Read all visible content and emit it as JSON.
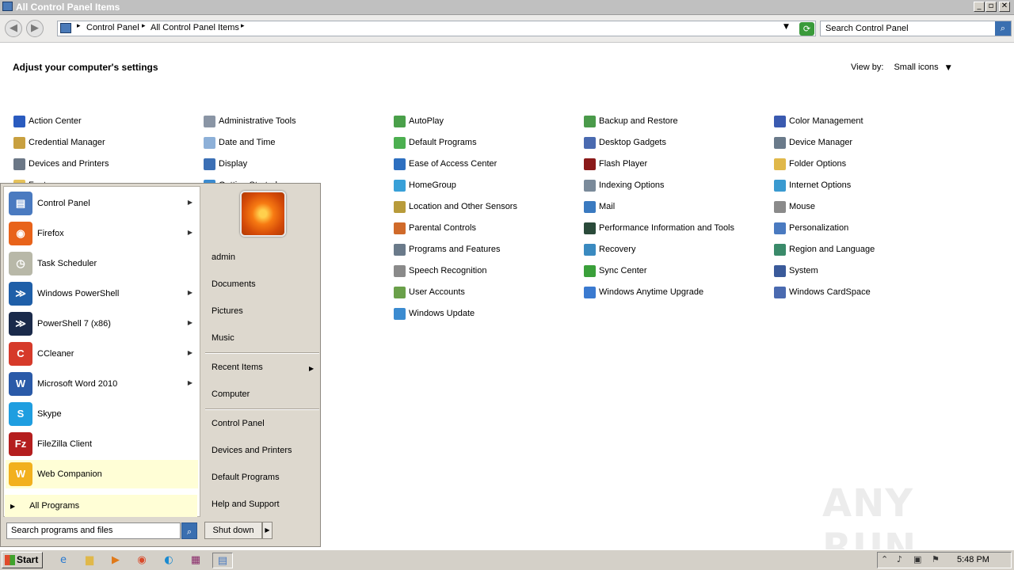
{
  "window": {
    "title": "All Control Panel Items"
  },
  "window_buttons": {
    "minimize": "_",
    "maximize": "▫",
    "close": "✕"
  },
  "nav": {
    "back": "◀",
    "forward": "▶"
  },
  "address": {
    "crumb1": "Control Panel",
    "crumb2": "All Control Panel Items"
  },
  "search": {
    "placeholder": "Search Control Panel"
  },
  "content": {
    "heading": "Adjust your computer's settings",
    "viewby_label": "View by:",
    "viewby_value": "Small icons",
    "columns": [
      [
        {
          "label": "Action Center",
          "icon": "flag-icon",
          "color": "#2a5bbf"
        },
        {
          "label": "Credential Manager",
          "icon": "vault-icon",
          "color": "#c8a040"
        },
        {
          "label": "Devices and Printers",
          "icon": "printer-icon",
          "color": "#6b7786"
        },
        {
          "label": "Fonts",
          "icon": "folder-icon",
          "color": "#e6c25a"
        }
      ],
      [
        {
          "label": "Administrative Tools",
          "icon": "tools-icon",
          "color": "#8a95a5"
        },
        {
          "label": "Date and Time",
          "icon": "calendar-icon",
          "color": "#8db0d8"
        },
        {
          "label": "Display",
          "icon": "monitor-icon",
          "color": "#3b6fb5"
        },
        {
          "label": "Getting Started",
          "icon": "start-icon",
          "color": "#3b8bd0"
        }
      ],
      [
        {
          "label": "AutoPlay",
          "icon": "autoplay-icon",
          "color": "#4aa04a"
        },
        {
          "label": "Default Programs",
          "icon": "default-programs-icon",
          "color": "#4caf50"
        },
        {
          "label": "Ease of Access Center",
          "icon": "ease-access-icon",
          "color": "#2d6fc0"
        },
        {
          "label": "HomeGroup",
          "icon": "homegroup-icon",
          "color": "#38a0d8"
        },
        {
          "label": "Location and Other Sensors",
          "icon": "sensor-icon",
          "color": "#b89b3a"
        },
        {
          "label": "Parental Controls",
          "icon": "parental-icon",
          "color": "#d06a2a"
        },
        {
          "label": "Programs and Features",
          "icon": "programs-icon",
          "color": "#6a7a8a"
        },
        {
          "label": "Speech Recognition",
          "icon": "microphone-icon",
          "color": "#8a8a8a"
        },
        {
          "label": "User Accounts",
          "icon": "users-icon",
          "color": "#6aa04a"
        },
        {
          "label": "Windows Update",
          "icon": "update-icon",
          "color": "#3b8bd0"
        }
      ],
      [
        {
          "label": "Backup and Restore",
          "icon": "backup-icon",
          "color": "#4a9a4a"
        },
        {
          "label": "Desktop Gadgets",
          "icon": "gadgets-icon",
          "color": "#4a6ab0"
        },
        {
          "label": "Flash Player",
          "icon": "flash-icon",
          "color": "#8a1a1a"
        },
        {
          "label": "Indexing Options",
          "icon": "indexing-icon",
          "color": "#7a8a9a"
        },
        {
          "label": "Mail",
          "icon": "mail-icon",
          "color": "#3a7ac0"
        },
        {
          "label": "Performance Information and Tools",
          "icon": "performance-icon",
          "color": "#2a4a3a"
        },
        {
          "label": "Recovery",
          "icon": "recovery-icon",
          "color": "#3a8ac0"
        },
        {
          "label": "Sync Center",
          "icon": "sync-icon",
          "color": "#3aa03a"
        },
        {
          "label": "Windows Anytime Upgrade",
          "icon": "windows-icon",
          "color": "#3a7ad0"
        }
      ],
      [
        {
          "label": "Color Management",
          "icon": "color-monitor-icon",
          "color": "#3a5ab0"
        },
        {
          "label": "Device Manager",
          "icon": "device-manager-icon",
          "color": "#6a7a8a"
        },
        {
          "label": "Folder Options",
          "icon": "folder-options-icon",
          "color": "#e0b84a"
        },
        {
          "label": "Internet Options",
          "icon": "internet-icon",
          "color": "#3a9ad0"
        },
        {
          "label": "Mouse",
          "icon": "mouse-icon",
          "color": "#8a8a8a"
        },
        {
          "label": "Personalization",
          "icon": "personalization-icon",
          "color": "#4a7ac0"
        },
        {
          "label": "Region and Language",
          "icon": "globe-icon",
          "color": "#3a8a6a"
        },
        {
          "label": "System",
          "icon": "system-icon",
          "color": "#3a5a9a"
        },
        {
          "label": "Windows CardSpace",
          "icon": "cardspace-icon",
          "color": "#4a6ab0"
        }
      ]
    ]
  },
  "start_menu": {
    "programs": [
      {
        "label": "Control Panel",
        "icon": "control-panel-icon",
        "color": "#4a7ac0",
        "glyph": "▤",
        "submenu": true
      },
      {
        "label": "Firefox",
        "icon": "firefox-icon",
        "color": "#e8631a",
        "glyph": "◉",
        "submenu": true
      },
      {
        "label": "Task Scheduler",
        "icon": "clock-icon",
        "color": "#b8b8a8",
        "glyph": "◷",
        "submenu": false
      },
      {
        "label": "Windows PowerShell",
        "icon": "powershell-icon",
        "color": "#1f5fa8",
        "glyph": "≫",
        "submenu": true
      },
      {
        "label": "PowerShell 7 (x86)",
        "icon": "powershell7-icon",
        "color": "#1a2a4a",
        "glyph": "≫",
        "submenu": true
      },
      {
        "label": "CCleaner",
        "icon": "ccleaner-icon",
        "color": "#d63a2a",
        "glyph": "C",
        "submenu": true
      },
      {
        "label": "Microsoft Word 2010",
        "icon": "word-icon",
        "color": "#2a5aa8",
        "glyph": "W",
        "submenu": true
      },
      {
        "label": "Skype",
        "icon": "skype-icon",
        "color": "#1f9ee0",
        "glyph": "S",
        "submenu": false
      },
      {
        "label": "FileZilla Client",
        "icon": "filezilla-icon",
        "color": "#b41e1e",
        "glyph": "Fz",
        "submenu": false
      },
      {
        "label": "Web Companion",
        "icon": "web-companion-icon",
        "color": "#f2b01e",
        "glyph": "W",
        "submenu": false,
        "highlight": true
      }
    ],
    "all_programs": "All Programs",
    "search_placeholder": "Search programs and files",
    "right": {
      "user": "admin",
      "documents": "Documents",
      "pictures": "Pictures",
      "music": "Music",
      "recent": "Recent Items",
      "computer": "Computer",
      "control_panel": "Control Panel",
      "devices": "Devices and Printers",
      "default_programs": "Default Programs",
      "help": "Help and Support"
    },
    "shutdown": "Shut down"
  },
  "taskbar": {
    "start": "Start",
    "apps": [
      {
        "name": "ie-taskbar-icon",
        "glyph": "e",
        "color": "#2a7ad0"
      },
      {
        "name": "explorer-taskbar-icon",
        "glyph": "▆",
        "color": "#e0b84a"
      },
      {
        "name": "media-player-taskbar-icon",
        "glyph": "▶",
        "color": "#e07a1a"
      },
      {
        "name": "chrome-taskbar-icon",
        "glyph": "◉",
        "color": "#d94a2a"
      },
      {
        "name": "edge-taskbar-icon",
        "glyph": "◐",
        "color": "#1a8ad0"
      },
      {
        "name": "winrar-taskbar-icon",
        "glyph": "▦",
        "color": "#8a2a6a"
      },
      {
        "name": "control-panel-taskbar-icon",
        "glyph": "▤",
        "color": "#4a7ac0"
      }
    ],
    "time": "5:48 PM"
  },
  "watermark": "ANY RUN"
}
